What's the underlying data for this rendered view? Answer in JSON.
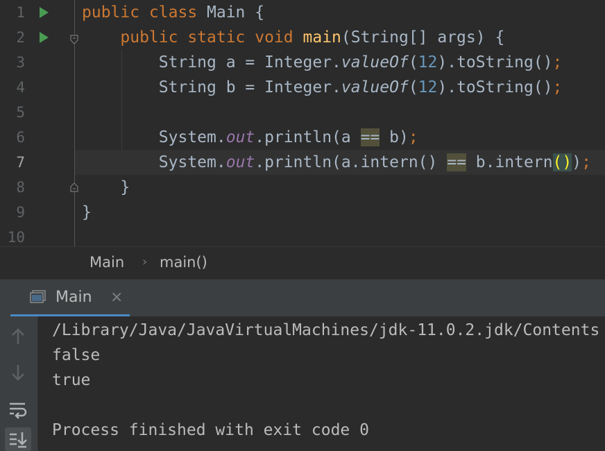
{
  "editor": {
    "current_line": 7,
    "line_numbers": [
      "1",
      "2",
      "3",
      "4",
      "5",
      "6",
      "7",
      "8",
      "9",
      "10"
    ],
    "lines": [
      {
        "tokens": [
          {
            "t": "public class ",
            "c": "kw"
          },
          {
            "t": "Main {",
            "c": ""
          }
        ]
      },
      {
        "tokens": [
          {
            "t": "    public static void ",
            "c": "kw"
          },
          {
            "t": "main",
            "c": "fn"
          },
          {
            "t": "(String[] args) {",
            "c": ""
          }
        ]
      },
      {
        "tokens": [
          {
            "t": "        String a = Integer.",
            "c": ""
          },
          {
            "t": "valueOf",
            "c": "it"
          },
          {
            "t": "(",
            "c": ""
          },
          {
            "t": "12",
            "c": "num"
          },
          {
            "t": ").toString()",
            "c": ""
          },
          {
            "t": ";",
            "c": "semi"
          }
        ]
      },
      {
        "tokens": [
          {
            "t": "        String b = Integer.",
            "c": ""
          },
          {
            "t": "valueOf",
            "c": "it"
          },
          {
            "t": "(",
            "c": ""
          },
          {
            "t": "12",
            "c": "num"
          },
          {
            "t": ").toString()",
            "c": ""
          },
          {
            "t": ";",
            "c": "semi"
          }
        ]
      },
      {
        "tokens": []
      },
      {
        "tokens": [
          {
            "t": "        System.",
            "c": ""
          },
          {
            "t": "out",
            "c": "field"
          },
          {
            "t": ".println(a ",
            "c": ""
          },
          {
            "t": "==",
            "c": "hl-op"
          },
          {
            "t": " b)",
            "c": ""
          },
          {
            "t": ";",
            "c": "semi"
          }
        ]
      },
      {
        "tokens": [
          {
            "t": "        System.",
            "c": ""
          },
          {
            "t": "out",
            "c": "field"
          },
          {
            "t": ".println(a.intern() ",
            "c": ""
          },
          {
            "t": "==",
            "c": "hl-op"
          },
          {
            "t": " b.intern",
            "c": ""
          },
          {
            "t": "()",
            "c": "hl-brace"
          },
          {
            "t": ")",
            "c": ""
          },
          {
            "t": ";",
            "c": "semi"
          }
        ]
      },
      {
        "tokens": [
          {
            "t": "    }",
            "c": ""
          }
        ]
      },
      {
        "tokens": [
          {
            "t": "}",
            "c": ""
          }
        ]
      },
      {
        "tokens": []
      }
    ]
  },
  "breadcrumbs": {
    "class_name": "Main",
    "separator": "›",
    "method_name": "main()"
  },
  "run_panel": {
    "tab_label": "Main",
    "close_glyph": "×",
    "toolbar": [
      {
        "name": "up-arrow-icon"
      },
      {
        "name": "down-arrow-icon"
      },
      {
        "name": "soft-wrap-icon"
      },
      {
        "name": "scroll-to-end-icon"
      }
    ],
    "output": [
      "/Library/Java/JavaVirtualMachines/jdk-11.0.2.jdk/Contents",
      "false",
      "true",
      "",
      "Process finished with exit code 0"
    ]
  },
  "colors": {
    "editor_bg": "#2b2b2b",
    "keyword": "#cc7832",
    "function": "#ffc66d",
    "number": "#6897bb",
    "field": "#9876aa",
    "text": "#a9b7c6",
    "run_icon": "#499c54",
    "tab_underline": "#4a88c7"
  }
}
